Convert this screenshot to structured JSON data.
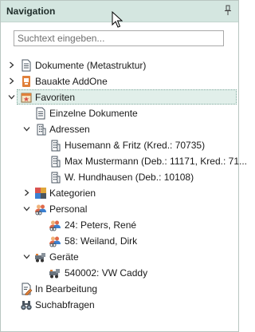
{
  "panel": {
    "title": "Navigation",
    "search_placeholder": "Suchtext eingeben..."
  },
  "tree": {
    "dokumente": "Dokumente (Metastruktur)",
    "bauakte": "Bauakte AddOne",
    "favoriten": "Favoriten",
    "einzelne": "Einzelne Dokumente",
    "adressen": "Adressen",
    "addr1": "Husemann & Fritz (Kred.: 70735)",
    "addr2": "Max Mustermann (Deb.: 11171, Kred.: 71...",
    "addr3": "W. Hundhausen (Deb.: 10108)",
    "kategorien": "Kategorien",
    "personal": "Personal",
    "pers1": "24: Peters, René",
    "pers2": "58: Weiland, Dirk",
    "geraete": "Geräte",
    "geraet1": "540002: VW Caddy",
    "bearbeitung": "In Bearbeitung",
    "suchabfragen": "Suchabfragen"
  },
  "colors": {
    "header_bg": "#d4e6e0",
    "selected_bg": "#e1efea",
    "accent_orange": "#e0803a"
  }
}
